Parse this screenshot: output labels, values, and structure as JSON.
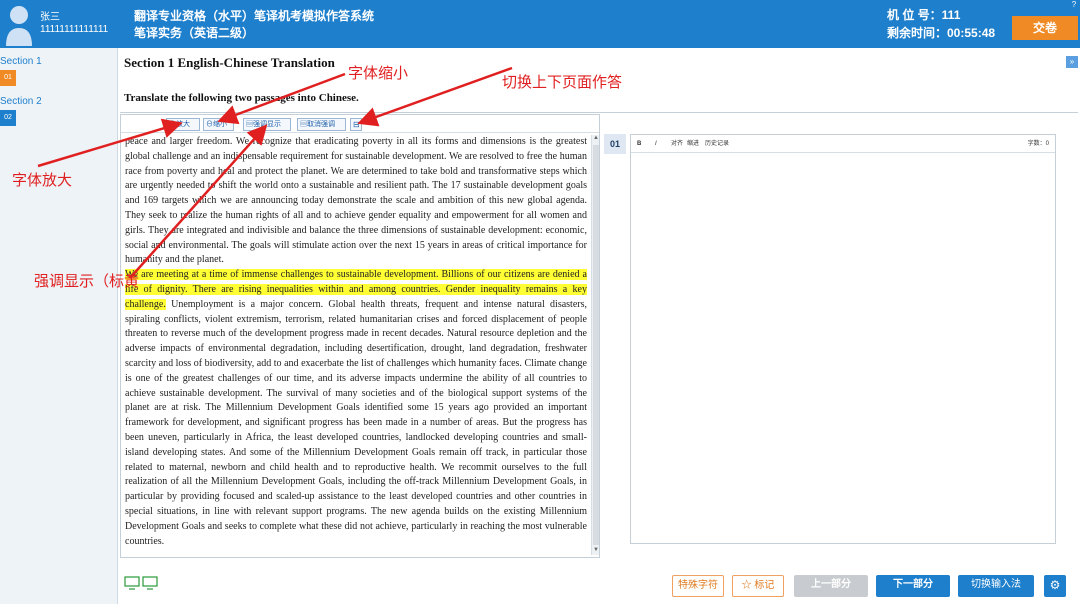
{
  "header": {
    "user_name": "张三",
    "user_id": "11111111111111",
    "title": "翻译专业资格（水平）笔译机考模拟作答系统",
    "subtitle": "笔译实务（英语二级）",
    "seat": "机 位 号：111",
    "time_remaining": "剩余时间：00:55:48",
    "submit_label": "交卷",
    "help": "?"
  },
  "sidebar": {
    "sections": [
      {
        "label": "Section 1",
        "badge": "01",
        "active": true
      },
      {
        "label": "Section 2",
        "badge": "02",
        "active": false
      }
    ]
  },
  "main": {
    "section_title": "Section 1  English-Chinese Translation",
    "instruction": "Translate the following two passages into Chinese.",
    "collapse": "»",
    "toolbar": {
      "zoom_in": "⊕放大",
      "zoom_out": "⊖缩小",
      "highlight": "▤强调显示",
      "unhighlight": "▤取消强调",
      "switch": "⊟"
    },
    "passage": {
      "para1": "peace and larger freedom. We recognize that eradicating poverty in all its forms and dimensions is the greatest global challenge and an indispensable requirement for sustainable development. We are resolved to free the human race from poverty and heal and protect the planet. We are determined to take bold and transformative steps which are urgently needed to shift the world onto a sustainable and resilient path. The 17 sustainable development goals and 169 targets which we are announcing today demonstrate the scale and ambition of this new global agenda. They seek to realize the human rights of all and to achieve gender equality and empowerment for all women and girls. They are integrated and indivisible and balance the three dimensions of sustainable development: economic, social and environmental. The goals will stimulate action over the next 15 years in areas of critical importance for humanity and the planet.",
      "para2_highlight": "We are meeting at a time of immense challenges to sustainable development. Billions of our citizens are denied a life of dignity. There are rising inequalities within and among countries. Gender inequality remains a key challenge.",
      "para2_rest": " Unemployment is a major concern. Global health threats, frequent and intense natural disasters, spiraling conflicts, violent extremism, terrorism, related humanitarian crises and forced displacement of people threaten to reverse much of the development progress made in recent decades. Natural resource depletion and the adverse impacts of environmental degradation, including desertification, drought, land degradation, freshwater scarcity and loss of biodiversity, add to and exacerbate the list of challenges which humanity faces. Climate change is one of the greatest challenges of our time, and its adverse impacts undermine the ability of all countries to achieve sustainable development. The survival of many societies and of the biological support systems of the planet are at risk. The Millennium Development Goals identified some 15 years ago provided an important framework for development, and significant progress has been made in a number of areas. But the progress has been uneven, particularly in Africa, the least developed countries, landlocked developing countries and small-island developing states. And some of the Millennium Development Goals remain off track, in particular those related to maternal, newborn and child health and to reproductive health. We recommit ourselves to the full realization of all the Millennium Development Goals, including the off-track Millennium Development Goals, in particular by providing focused and scaled-up assistance to the least developed countries and other countries in special situations, in line with relevant support programs. The new agenda builds on the existing Millennium Development Goals and seeks to complete what these did not achieve, particularly in reaching the most vulnerable countries."
    },
    "answer": {
      "question_number": "01",
      "toolbar": {
        "bold": "B",
        "italic": "I",
        "align": "对齐",
        "indent": "缩进",
        "history": "历史记录",
        "word_count": "字数：0"
      }
    }
  },
  "footer": {
    "special_chars": "特殊字符",
    "mark": "☆ 标记",
    "prev": "上一部分",
    "next": "下一部分",
    "switch_ime": "切换输入法",
    "settings": "⚙"
  },
  "annotations": {
    "zoom_out": "字体缩小",
    "switch_page": "切换上下页面作答",
    "zoom_in": "字体放大",
    "highlight": "强调显示（标黄"
  },
  "colors": {
    "header_bg": "#1e7fcc",
    "submit_bg": "#f08a24",
    "highlight": "#ffff33",
    "annotation": "#e02020"
  }
}
